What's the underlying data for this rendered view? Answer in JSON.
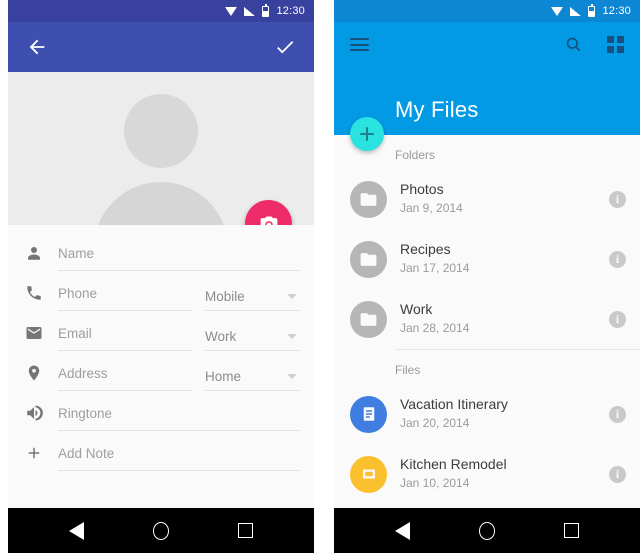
{
  "theme": {
    "indigo_statusbar": "#39419e",
    "indigo_appbar": "#3f4fb0",
    "blue_statusbar": "#0d87d3",
    "blue_appbar": "#039ae5",
    "pink_fab": "#ef2c6a",
    "cyan_fab": "#2ae3e0",
    "card_bg": "#fafafa",
    "avatar_bg": "#ececec"
  },
  "left_panel": {
    "status_bar": {
      "clock": "12:30",
      "icons": [
        "wifi-icon",
        "signal-icon",
        "battery-icon"
      ]
    },
    "app_bar": {
      "back_icon": "back-arrow-icon",
      "confirm_icon": "checkmark-icon"
    },
    "avatar": {
      "placeholder_name": "person-placeholder-avatar",
      "camera_fab_icon": "camera-icon"
    },
    "fields": [
      {
        "icon": "person-icon",
        "placeholder": "Name",
        "value": "",
        "type": null
      },
      {
        "icon": "phone-icon",
        "placeholder": "Phone",
        "value": "",
        "type": "Mobile"
      },
      {
        "icon": "email-icon",
        "placeholder": "Email",
        "value": "",
        "type": "Work"
      },
      {
        "icon": "location-icon",
        "placeholder": "Address",
        "value": "",
        "type": "Home"
      },
      {
        "icon": "speaker-icon",
        "placeholder": "Ringtone",
        "value": "",
        "type": null
      },
      {
        "icon": "plus-icon",
        "placeholder": "Add Note",
        "value": "",
        "type": null
      }
    ],
    "nav_bar": [
      "back-nav-icon",
      "home-nav-icon",
      "recents-nav-icon"
    ]
  },
  "right_panel": {
    "status_bar": {
      "clock": "12:30",
      "icons": [
        "wifi-icon",
        "signal-icon",
        "battery-icon"
      ]
    },
    "app_bar": {
      "menu_icon": "hamburger-menu-icon",
      "search_icon": "search-icon",
      "grid_icon": "grid-view-icon",
      "title": "My Files",
      "add_fab_icon": "plus-icon"
    },
    "sections": [
      {
        "label": "Folders",
        "items": [
          {
            "icon": "folder-icon",
            "title": "Photos",
            "date": "Jan 9, 2014",
            "info": "i"
          },
          {
            "icon": "folder-icon",
            "title": "Recipes",
            "date": "Jan 17, 2014",
            "info": "i"
          },
          {
            "icon": "folder-icon",
            "title": "Work",
            "date": "Jan 28, 2014",
            "info": "i"
          }
        ]
      },
      {
        "label": "Files",
        "items": [
          {
            "icon": "document-icon",
            "title": "Vacation Itinerary",
            "date": "Jan 20, 2014",
            "info": "i"
          },
          {
            "icon": "presentation-icon",
            "title": "Kitchen Remodel",
            "date": "Jan 10, 2014",
            "info": "i"
          }
        ]
      }
    ],
    "nav_bar": [
      "back-nav-icon",
      "home-nav-icon",
      "recents-nav-icon"
    ]
  }
}
